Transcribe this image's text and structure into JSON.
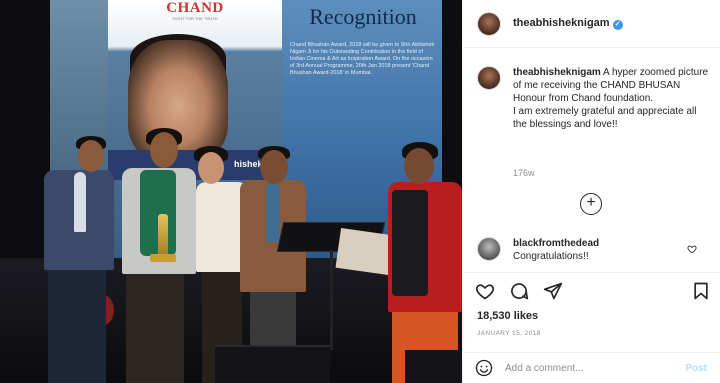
{
  "photo": {
    "brand_logo": "CHAND",
    "brand_tagline": "FIGHT FOR THE TRUTH",
    "screen_title": "Recognition",
    "screen_body": "Chand Bhushan Award, 2018 will be given to Shri Abhishek Nigam Ji for his Outstanding Contribution in the field of Indian Cinema & Art as Inspiration Award. On the occasion of 3rd Annual Programme, 20th Jan 2018 present 'Chand Bhushan Award-2018' in Mumbai.",
    "banner_text": "hishek Nig"
  },
  "header": {
    "username": "theabhisheknigam",
    "verified_mark": "✓"
  },
  "caption": {
    "username": "theabhisheknigam",
    "text_lines": [
      "A hyper zoomed picture of me receiving the CHAND BHUSAN Honour from Chand foundation.",
      "I am extremely grateful and appreciate all the blessings and love!!"
    ],
    "time": "176w"
  },
  "load_more": "+",
  "comments": [
    {
      "username": "blackfromthedead",
      "text": "Congratulations!!"
    }
  ],
  "likes": "18,530 likes",
  "date": "JANUARY 15, 2018",
  "add_comment": {
    "placeholder": "Add a comment...",
    "post_label": "Post"
  },
  "icons": {
    "like": "heart-icon",
    "comment": "comment-icon",
    "share": "share-icon",
    "save": "bookmark-icon",
    "emoji": "smiley-icon",
    "comment_like": "heart-icon"
  },
  "colors": {
    "verified": "#3897f0",
    "post_disabled": "#b2dffc",
    "muted": "#8e8e8e"
  }
}
